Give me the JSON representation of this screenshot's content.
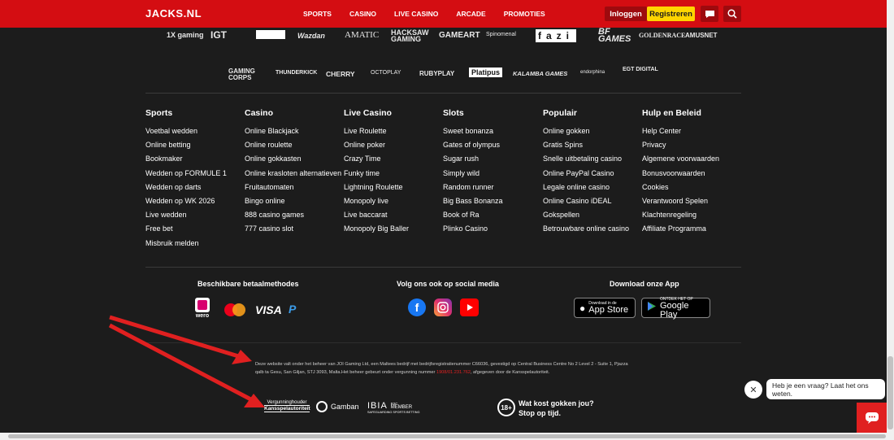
{
  "header": {
    "logo": "JACKS.NL",
    "nav": [
      "SPORTS",
      "CASINO",
      "LIVE CASINO",
      "ARCADE",
      "PROMOTIES"
    ],
    "login_label": "Inloggen",
    "register_label": "Registreren",
    "icons": [
      "chat-icon",
      "search-icon"
    ]
  },
  "providers_row1": [
    "1X gaming",
    "IGT",
    "SPINOMENAL_BOX",
    "Wazdan",
    "AMATIC",
    "HACKSAW GAMING",
    "GAMEART",
    "Spinomenal",
    "fazi",
    "BF GAMES",
    "GOLDENRACE",
    "AMUSNET"
  ],
  "providers_row2": [
    "GAMING CORPS",
    "THUNDERKICK",
    "CHERRY",
    "OCTOPLAY",
    "RUBYPLAY",
    "Platipus",
    "KALAMBA GAMES",
    "endorphina",
    "EGT DIGITAL"
  ],
  "footer_columns": [
    {
      "title": "Sports",
      "links": [
        "Voetbal wedden",
        "Online betting",
        "Bookmaker",
        "Wedden op FORMULE 1",
        "Wedden op darts",
        "Wedden op WK 2026",
        "Live wedden",
        "Free bet",
        "Misbruik melden"
      ]
    },
    {
      "title": "Casino",
      "links": [
        "Online Blackjack",
        "Online roulette",
        "Online gokkasten",
        "Online kraslo­ten alternatieven",
        "Fruitautomaten",
        "Bingo online",
        "888 casino games",
        "777 casino slot"
      ]
    },
    {
      "title": "Live Casino",
      "links": [
        "Live Roulette",
        "Online poker",
        "Crazy Time",
        "Funky time",
        "Lightning Roulette",
        "Monopoly live",
        "Live baccarat",
        "Monopoly Big Baller"
      ]
    },
    {
      "title": "Slots",
      "links": [
        "Sweet bonanza",
        "Gates of olympus",
        "Sugar rush",
        "Simply wild",
        "Random runner",
        "Big Bass Bonanza",
        "Book of Ra",
        "Plinko Casino"
      ]
    },
    {
      "title": "Populair",
      "links": [
        "Online gokken",
        "Gratis Spins",
        "Snelle uitbetaling casino",
        "Online PayPal Casino",
        "Legale online casino",
        "Online Casino iDEAL",
        "Gokspellen",
        "Betrouwbare online casino"
      ]
    },
    {
      "title": "Hulp en Beleid",
      "links": [
        "Help Center",
        "Privacy",
        "Algemene voorwaarden",
        "Bonusvoorwaarden",
        "Cookies",
        "Verantwoord Spelen",
        "Klachtenregeling",
        "Affiliate Programma"
      ]
    }
  ],
  "payments": {
    "title": "Beschikbare betaalmethodes",
    "wero_label": "wero",
    "visa_label": "VISA"
  },
  "social": {
    "title": "Volg ons ook op social media"
  },
  "app": {
    "title": "Download onze App",
    "appstore_small": "Download in de",
    "appstore_big": "App Store",
    "googleplay_small": "ONTDEK HET OP",
    "googleplay_big": "Google Play"
  },
  "legal": {
    "text1": "Deze website valt onder het beheer van JOI Gaming Ltd, een Maltees bedrijf met bedrijfsregistratienummer C66036, gevestigd op Central Business Centre No 2 Level 2 - Suite 1, Pjazza qalb ta Gesu, San Giljan, STJ 3093, Malta.Het beheer gebeurt onder vergunning nummer ",
    "license_number": "1908/01.231.762",
    "text2": ", afgegeven door de Kansspelautoriteit."
  },
  "badges": {
    "ksa_line1": "Vergunninghouder",
    "ksa_line2": "Kansspelautoriteit",
    "gamban": "Gamban",
    "ibia": "IBIA",
    "ibia_sub1": "B2C",
    "ibia_sub2": "MEMBER",
    "ibia_sub3": "SAFEGUARDING SPORTS BETTING",
    "age": "18+",
    "age_line1": "Wat kost gokken jou?",
    "age_line2": "Stop op tijd."
  },
  "chat": {
    "message": "Heb je een vraag? Laat het ons weten."
  },
  "colors": {
    "brand_red": "#d40d12",
    "accent_yellow": "#ffd400",
    "background": "#1c1c1c"
  }
}
